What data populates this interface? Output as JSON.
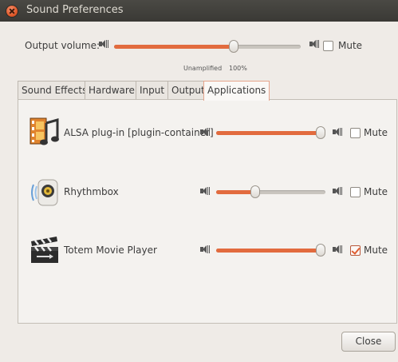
{
  "window": {
    "title": "Sound Preferences"
  },
  "output": {
    "label": "Output volume:",
    "level": 0.64,
    "unamplified_label": "Unamplified",
    "percent_label": "100%",
    "mute_label": "Mute",
    "muted": false
  },
  "tabs": [
    {
      "label": "Sound Effects",
      "active": false
    },
    {
      "label": "Hardware",
      "active": false
    },
    {
      "label": "Input",
      "active": false
    },
    {
      "label": "Output",
      "active": false
    },
    {
      "label": "Applications",
      "active": true
    }
  ],
  "applications": [
    {
      "name": "ALSA plug-in [plugin-container]",
      "level": 1.0,
      "mute_label": "Mute",
      "muted": false,
      "icon": "film-music-icon"
    },
    {
      "name": "Rhythmbox",
      "level": 0.36,
      "mute_label": "Mute",
      "muted": false,
      "icon": "speaker-app-icon"
    },
    {
      "name": "Totem Movie Player",
      "level": 1.0,
      "mute_label": "Mute",
      "muted": true,
      "icon": "clapperboard-icon"
    }
  ],
  "buttons": {
    "close_label": "Close"
  },
  "colors": {
    "accent": "#e26b3e",
    "titlebar": "#3c3b37",
    "window_bg": "#efebe7"
  }
}
